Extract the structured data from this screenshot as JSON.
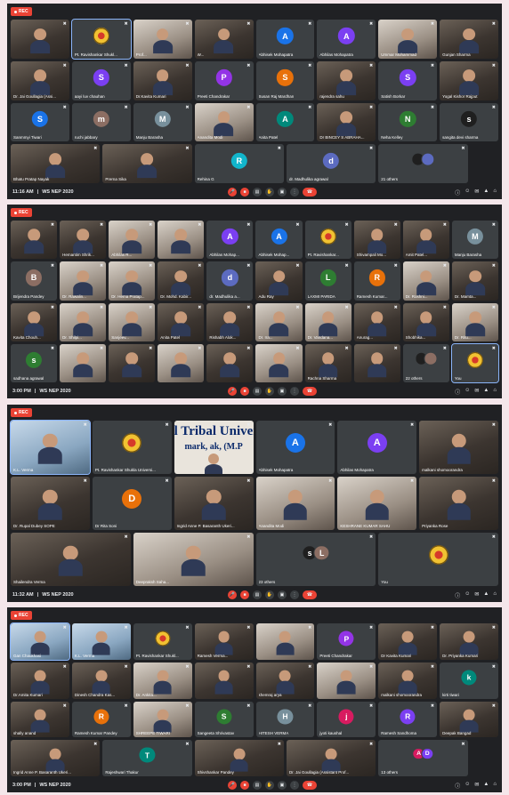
{
  "common": {
    "rec_label": "REC",
    "separator": "|",
    "meeting": "WS NEP 2020",
    "controls": [
      "mic-icon",
      "camera-icon",
      "captions-icon",
      "raise-hand-icon",
      "present-icon",
      "more-icon",
      "end-call-icon"
    ],
    "right_icons": [
      "info-icon",
      "people-icon",
      "chat-icon",
      "activities-icon",
      "lock-icon"
    ]
  },
  "screens": [
    {
      "time": "11:16 AM",
      "tiles": [
        {
          "name": "",
          "kind": "pic"
        },
        {
          "name": "Pt. Ravishankar Shukl...",
          "kind": "logo",
          "active": true
        },
        {
          "name": "Prof...",
          "kind": "pic",
          "tone": "light"
        },
        {
          "name": "W...",
          "kind": "pic"
        },
        {
          "name": "Abhisek Mohapatra",
          "letter": "A",
          "color": "#1a73e8"
        },
        {
          "name": "Abhilas Mohapatra",
          "letter": "A",
          "color": "#7b3ff2"
        },
        {
          "name": "Ummar Mohammad",
          "kind": "pic",
          "tone": "light"
        },
        {
          "name": "Gunjan Sharma",
          "kind": "pic"
        },
        {
          "name": "Dr. Jai Goullagia (Assi...",
          "kind": "pic"
        },
        {
          "name": "aayi luv chauhan",
          "letter": "S",
          "color": "#7b3ff2"
        },
        {
          "name": "Dr.Kavita Kumari",
          "kind": "pic"
        },
        {
          "name": "Preeti Chandrakar",
          "letter": "P",
          "color": "#9334e6"
        },
        {
          "name": "Susan Raj Mardhan",
          "letter": "S",
          "color": "#e8710a"
        },
        {
          "name": "rajendra sahu",
          "kind": "pic"
        },
        {
          "name": "Satish Borkar",
          "letter": "S",
          "color": "#7b3ff2"
        },
        {
          "name": "Yogal Kishor Rajput",
          "kind": "pic"
        },
        {
          "name": "Sanmmyi Tiwari",
          "letter": "S",
          "color": "#1a73e8"
        },
        {
          "name": "ruchi jabbary",
          "letter": "m",
          "color": "#8c6e63"
        },
        {
          "name": "Manju Barasha",
          "letter": "M",
          "color": "#78909c"
        },
        {
          "name": "Anandita Modi",
          "kind": "pic",
          "tone": "light"
        },
        {
          "name": "Anita Patel",
          "letter": "A",
          "color": "#00897b"
        },
        {
          "name": "Dr BINCEY S ABRAHA...",
          "kind": "pic"
        },
        {
          "name": "Neha Kelley",
          "letter": "N",
          "color": "#2e7d32"
        },
        {
          "name": "sangita devi sharma",
          "letter": "s",
          "color": "#1f1f1f"
        },
        {
          "name": "Bhatu Pratap Nayak",
          "kind": "pic"
        },
        {
          "name": "Prerna Sika",
          "kind": "pic"
        },
        {
          "name": "Rehina G",
          "letter": "R",
          "color": "#12b5cb"
        },
        {
          "name": "dr. Madhulika agrawal",
          "letter": "d",
          "color": "#5c6bc0"
        },
        {
          "name": "21 others",
          "kind": "others",
          "letters": [
            "",
            ""
          ]
        },
        {
          "name": "You",
          "kind": "logo"
        }
      ]
    },
    {
      "time": "3:00 PM",
      "tiles": [
        {
          "name": "",
          "kind": "pic"
        },
        {
          "name": "Hemantim Shrik...",
          "kind": "pic"
        },
        {
          "name": "Abhilas R...",
          "kind": "pic",
          "tone": "light"
        },
        {
          "name": "",
          "kind": "pic",
          "tone": "light"
        },
        {
          "name": "Abhilas Mohap...",
          "letter": "A",
          "color": "#7b3ff2"
        },
        {
          "name": "Abhisek Mohap...",
          "letter": "A",
          "color": "#1a73e8"
        },
        {
          "name": "Pt. Ravishankar...",
          "kind": "logo"
        },
        {
          "name": "Shivampali Mo...",
          "kind": "pic"
        },
        {
          "name": "Amit Patel...",
          "kind": "pic"
        },
        {
          "name": "Manju Barasha",
          "letter": "M",
          "color": "#78909c"
        },
        {
          "name": "Brijendra Pandey",
          "letter": "B",
          "color": "#8c6e63"
        },
        {
          "name": "Dr. Rawalin...",
          "kind": "pic",
          "tone": "light"
        },
        {
          "name": "Dr. Hema Pratap...",
          "kind": "pic",
          "tone": "light"
        },
        {
          "name": "Dr. Mohd. Kabir...",
          "kind": "pic"
        },
        {
          "name": "dr. Madhulika a...",
          "letter": "d",
          "color": "#5c6bc0"
        },
        {
          "name": "Adu Ray",
          "kind": "pic"
        },
        {
          "name": "LAXMI PARIDA",
          "letter": "L",
          "color": "#2e7d32"
        },
        {
          "name": "Ramesh Kumar...",
          "letter": "R",
          "color": "#e8710a"
        },
        {
          "name": "Dr. Roshni...",
          "kind": "pic",
          "tone": "light"
        },
        {
          "name": "Dr. Mamta...",
          "kind": "pic"
        },
        {
          "name": "Kavita Chouh...",
          "kind": "pic"
        },
        {
          "name": "Dr. Shilpi...",
          "kind": "pic",
          "tone": "light"
        },
        {
          "name": "Sanjeev...",
          "kind": "pic",
          "tone": "light"
        },
        {
          "name": "Anita Patel",
          "kind": "pic"
        },
        {
          "name": "Rishabh Alok...",
          "kind": "pic"
        },
        {
          "name": "Dr. Ira...",
          "kind": "pic",
          "tone": "light"
        },
        {
          "name": "Dr. Vandana...",
          "kind": "pic",
          "tone": "light"
        },
        {
          "name": "Anurag...",
          "kind": "pic"
        },
        {
          "name": "Shobhika...",
          "kind": "pic"
        },
        {
          "name": "Dr. Ritu...",
          "kind": "pic",
          "tone": "light"
        },
        {
          "name": "sadhana agrawal",
          "letter": "s",
          "color": "#2e7d32"
        },
        {
          "name": "",
          "kind": "pic",
          "tone": "light"
        },
        {
          "name": "",
          "kind": "pic"
        },
        {
          "name": "",
          "kind": "pic",
          "tone": "light"
        },
        {
          "name": "",
          "kind": "pic"
        },
        {
          "name": "",
          "kind": "pic",
          "tone": "light"
        },
        {
          "name": "Rachna Sharma",
          "kind": "pic"
        },
        {
          "name": "",
          "kind": "pic"
        },
        {
          "name": "22 others",
          "kind": "others",
          "letters": [
            "",
            ""
          ]
        },
        {
          "name": "You",
          "kind": "logo",
          "active": true
        }
      ]
    },
    {
      "time": "11:32 AM",
      "tiles": [
        {
          "name": "K.L. Verma",
          "kind": "pic",
          "tone": "blue",
          "active": true
        },
        {
          "name": "Pt. Ravishankar Shukla Universi...",
          "kind": "logo"
        },
        {
          "name": "",
          "kind": "banner",
          "banner": "l Tribal Univers",
          "banner2": "mark, ak, (M.P"
        },
        {
          "name": "Abhisek Mohapatra",
          "letter": "A",
          "color": "#1a73e8"
        },
        {
          "name": "Abhilas Mohapatra",
          "letter": "A",
          "color": "#7b3ff2"
        },
        {
          "name": "malkani shomoorandra",
          "kind": "pic"
        },
        {
          "name": "Dr. Rupal Dubey SOPE",
          "kind": "pic"
        },
        {
          "name": "Dr Rita Soni",
          "letter": "D",
          "color": "#e8710a"
        },
        {
          "name": "Ingrid Anne P. Basaranth Ukeri...",
          "kind": "pic"
        },
        {
          "name": "Anandita Modi",
          "kind": "pic",
          "tone": "light"
        },
        {
          "name": "KESHRANE KUMAR SAHU",
          "kind": "pic",
          "tone": "light"
        },
        {
          "name": "Priyanka Rose",
          "kind": "pic"
        },
        {
          "name": "Shailendra Verma",
          "kind": "pic"
        },
        {
          "name": "Deepraksh Saha...",
          "kind": "pic",
          "tone": "light"
        },
        {
          "name": "23 others",
          "kind": "others",
          "letters": [
            "s",
            "L"
          ]
        },
        {
          "name": "You",
          "kind": "logo"
        }
      ]
    },
    {
      "time": "3:00 PM",
      "tiles": [
        {
          "name": "Gan Chaukhasi",
          "kind": "pic",
          "tone": "blue",
          "active": true
        },
        {
          "name": "K.L. Verma",
          "kind": "pic",
          "tone": "blue"
        },
        {
          "name": "Pt. Ravishankar Shukl...",
          "kind": "logo"
        },
        {
          "name": "Ramesh Verma...",
          "kind": "pic"
        },
        {
          "name": "",
          "kind": "pic",
          "tone": "light"
        },
        {
          "name": "Preeti Chandrakar",
          "letter": "P",
          "color": "#9334e6"
        },
        {
          "name": "Dr Kavita Kumari",
          "kind": "pic"
        },
        {
          "name": "Dr. Priyanka Kumari",
          "kind": "pic"
        },
        {
          "name": "Dr.Amita Kumari",
          "kind": "pic"
        },
        {
          "name": "Dinesh Chandra Kas...",
          "kind": "pic"
        },
        {
          "name": "Dr. Ankita...",
          "kind": "pic",
          "tone": "light"
        },
        {
          "name": "",
          "kind": "pic"
        },
        {
          "name": "khemraj arya",
          "kind": "pic"
        },
        {
          "name": "",
          "kind": "pic",
          "tone": "light"
        },
        {
          "name": "malkani shomoorandra",
          "kind": "pic"
        },
        {
          "name": "kirti tiwari",
          "letter": "k",
          "color": "#00897b"
        },
        {
          "name": "shally anand",
          "kind": "pic"
        },
        {
          "name": "Ramesh Kumar Pandey",
          "letter": "R",
          "color": "#e8710a"
        },
        {
          "name": "SHREEPE TIWARI",
          "kind": "pic",
          "tone": "light"
        },
        {
          "name": "Sangeeta Shrivastav",
          "letter": "S",
          "color": "#2e7d32"
        },
        {
          "name": "HITESH VERMA",
          "letter": "H",
          "color": "#78909c"
        },
        {
          "name": "jyoti kaushal",
          "letter": "j",
          "color": "#d81b60"
        },
        {
          "name": "Ramesh Sandhoma",
          "letter": "R",
          "color": "#7b3ff2"
        },
        {
          "name": "Deepak Bangad",
          "kind": "pic"
        },
        {
          "name": "Ingrid Anne P. Basaranth Ukeri...",
          "kind": "pic"
        },
        {
          "name": "Rajeshwari Thakur",
          "letter": "T",
          "color": "#00897b"
        },
        {
          "name": "Shivshankar Pandey",
          "kind": "pic"
        },
        {
          "name": "Dr. Jai Goullagia (Assistant Prof...",
          "kind": "pic"
        },
        {
          "name": "13 others",
          "kind": "others",
          "letters": [
            "A",
            "D"
          ]
        },
        {
          "name": "You",
          "kind": "logo"
        }
      ]
    }
  ]
}
